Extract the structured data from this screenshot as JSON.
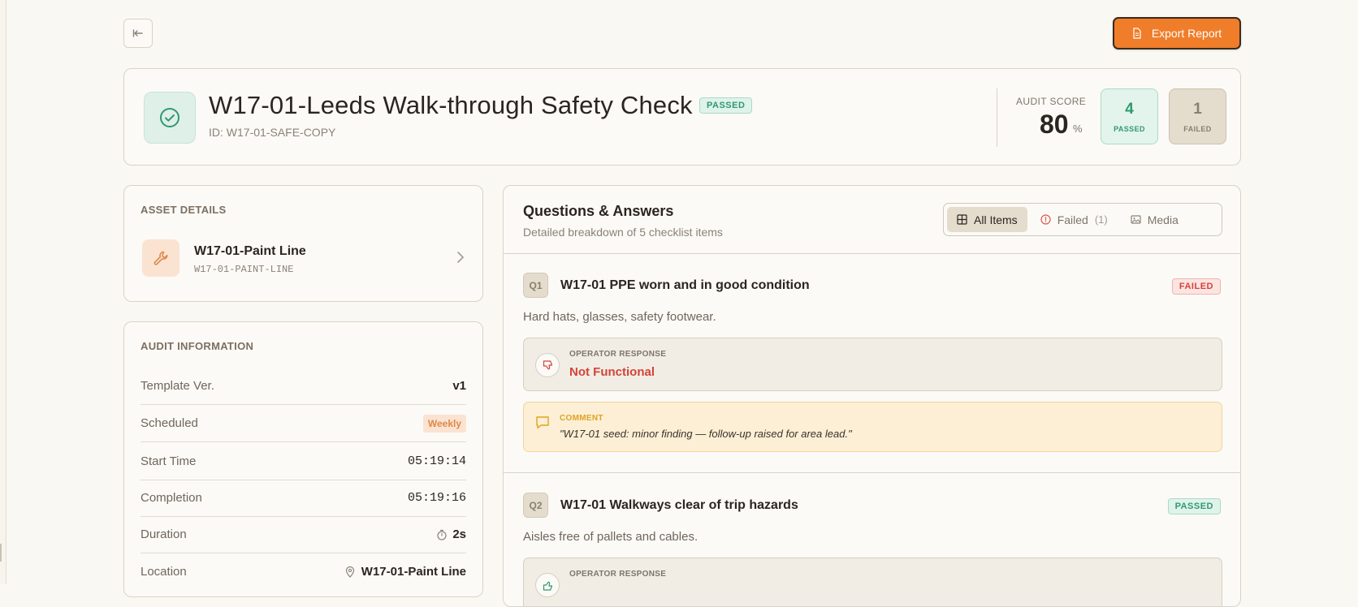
{
  "toolbar": {
    "back_label": "Back",
    "export_label": "Export Report"
  },
  "header": {
    "title": "W17-01-Leeds Walk-through Safety Check",
    "status": "PASSED",
    "id_text": "ID: W17-01-SAFE-COPY",
    "score_label": "AUDIT SCORE",
    "score_value": "80",
    "score_unit": "%",
    "passed_count": "4",
    "passed_label": "PASSED",
    "failed_count": "1",
    "failed_label": "FAILED"
  },
  "asset": {
    "section_title": "ASSET DETAILS",
    "name": "W17-01-Paint Line",
    "code": "W17-01-PAINT-LINE"
  },
  "audit_info": {
    "section_title": "AUDIT INFORMATION",
    "template_key": "Template Ver.",
    "template_val": "v1",
    "scheduled_key": "Scheduled",
    "scheduled_val": "Weekly",
    "start_key": "Start Time",
    "start_val": "05:19:14",
    "completion_key": "Completion",
    "completion_val": "05:19:16",
    "duration_key": "Duration",
    "duration_val": "2s",
    "location_key": "Location",
    "location_val": "W17-01-Paint Line"
  },
  "qa": {
    "title": "Questions & Answers",
    "subtitle": "Detailed breakdown of 5 checklist items",
    "filters": {
      "all": "All Items",
      "failed": "Failed",
      "failed_count": "(1)",
      "media": "Media"
    },
    "q1": {
      "num": "Q1",
      "title": "W17-01 PPE worn and in good condition",
      "status": "FAILED",
      "desc": "Hard hats, glasses, safety footwear.",
      "resp_label": "OPERATOR RESPONSE",
      "resp_val": "Not Functional",
      "comment_label": "COMMENT",
      "comment_text": "\"W17-01 seed: minor finding — follow-up raised for area lead.\""
    },
    "q2": {
      "num": "Q2",
      "title": "W17-01 Walkways clear of trip hazards",
      "status": "PASSED",
      "desc": "Aisles free of pallets and cables.",
      "resp_label": "OPERATOR RESPONSE"
    }
  },
  "colors": {
    "accent": "#f07d2a",
    "pass": "#2f9a6e",
    "fail": "#d4433a",
    "comment": "#e0a322"
  },
  "icons": [
    "arrow-left-icon",
    "document-icon",
    "check-circle-icon",
    "wrench-icon",
    "chevron-right-icon",
    "grid-icon",
    "alert-circle-icon",
    "image-icon",
    "thumbs-down-icon",
    "thumbs-up-icon",
    "comment-icon",
    "timer-icon",
    "map-pin-icon"
  ]
}
